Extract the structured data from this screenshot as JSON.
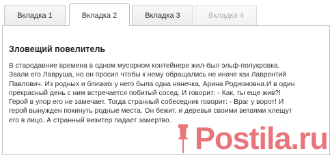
{
  "tabs": [
    {
      "label": "Вкладка 1"
    },
    {
      "label": "Вкладка 2"
    },
    {
      "label": "Вкладка 3"
    },
    {
      "label": "Вкладка 4"
    }
  ],
  "active_tab": "Вкладка 2",
  "disabled_tab": "Вкладка 4",
  "panel": {
    "title": "Зловещий повелитель",
    "lines": [
      "В стародавние времена в одном мусорном контейнере жил-был эльф-полукровка.",
      "Звали его Лавруша, но он просил чтобы к нему обращались не иначе как Лаврентий",
      "Павлович. Из родных и близких у него была одна нянечка, Арина Родионовна.И в один",
      "прекрасный день с ним встречается побитый сосед. И говорит: - Как, ты еще жив?!",
      "Герой в упор его не замечает. Тогда странный собеседник говорит: - Враг у ворот! И",
      "герой вынужден покинуть родные места. Он бежит, и деревья своими ветвями хлещут",
      "его в лицо. А странный визитер падает замертво."
    ]
  },
  "watermark": {
    "text": "Postila.ru",
    "color": "#e5636b",
    "icon": "postila-pin-icon"
  }
}
